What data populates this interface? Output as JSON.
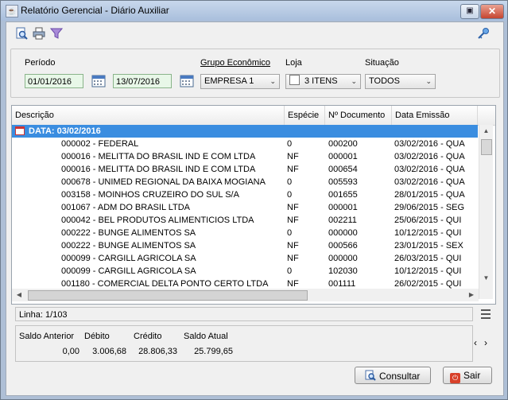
{
  "window": {
    "title": "Relatório Gerencial - Diário Auxiliar"
  },
  "toolbar": {
    "icons": [
      "search-doc-icon",
      "print-icon",
      "filter-icon",
      "key-icon"
    ]
  },
  "filters": {
    "periodo_label": "Período",
    "date_from": "01/01/2016",
    "date_to": "13/07/2016",
    "grupo_label": "Grupo Econômico",
    "grupo_value": "EMPRESA 1",
    "loja_label": "Loja",
    "loja_value": "3 ITENS",
    "situacao_label": "Situação",
    "situacao_value": "TODOS"
  },
  "grid": {
    "columns": [
      "Descrição",
      "Espécie",
      "Nº Documento",
      "Data Emissão"
    ],
    "group_label": "DATA: 03/02/2016",
    "rows": [
      {
        "desc": "000002 - FEDERAL",
        "esp": "0",
        "doc": "000200",
        "data": "03/02/2016 - QUA"
      },
      {
        "desc": "000016 - MELITTA DO BRASIL IND E COM LTDA",
        "esp": "NF",
        "doc": "000001",
        "data": "03/02/2016 - QUA"
      },
      {
        "desc": "000016 - MELITTA DO BRASIL IND E COM LTDA",
        "esp": "NF",
        "doc": "000654",
        "data": "03/02/2016 - QUA"
      },
      {
        "desc": "000678 - UNIMED REGIONAL DA BAIXA MOGIANA",
        "esp": "0",
        "doc": "005593",
        "data": "03/02/2016 - QUA"
      },
      {
        "desc": "003158 - MOINHOS CRUZEIRO DO SUL S/A",
        "esp": "0",
        "doc": "001655",
        "data": "28/01/2015 - QUA"
      },
      {
        "desc": "001067 - ADM DO BRASIL LTDA",
        "esp": "NF",
        "doc": "000001",
        "data": "29/06/2015 - SEG"
      },
      {
        "desc": "000042 - BEL PRODUTOS ALIMENTICIOS LTDA",
        "esp": "NF",
        "doc": "002211",
        "data": "25/06/2015 - QUI"
      },
      {
        "desc": "000222 - BUNGE ALIMENTOS SA",
        "esp": "0",
        "doc": "000000",
        "data": "10/12/2015 - QUI"
      },
      {
        "desc": "000222 - BUNGE ALIMENTOS SA",
        "esp": "NF",
        "doc": "000566",
        "data": "23/01/2015 - SEX"
      },
      {
        "desc": "000099 - CARGILL AGRICOLA SA",
        "esp": "NF",
        "doc": "000000",
        "data": "26/03/2015 - QUI"
      },
      {
        "desc": "000099 - CARGILL AGRICOLA SA",
        "esp": "0",
        "doc": "102030",
        "data": "10/12/2015 - QUI"
      },
      {
        "desc": "001180 - COMERCIAL DELTA PONTO CERTO LTDA",
        "esp": "NF",
        "doc": "001111",
        "data": "26/02/2015 - QUI"
      }
    ]
  },
  "status": {
    "linha": "Linha: 1/103"
  },
  "totals": {
    "labels": [
      "Saldo Anterior",
      "Débito",
      "Crédito",
      "Saldo Atual"
    ],
    "values": [
      "0,00",
      "3.006,68",
      "28.806,33",
      "25.799,65"
    ]
  },
  "buttons": {
    "consultar": "Consultar",
    "sair": "Sair"
  },
  "colors": {
    "group_bar": "#3a8de0",
    "date_field_bg": "#e8f7e8"
  }
}
